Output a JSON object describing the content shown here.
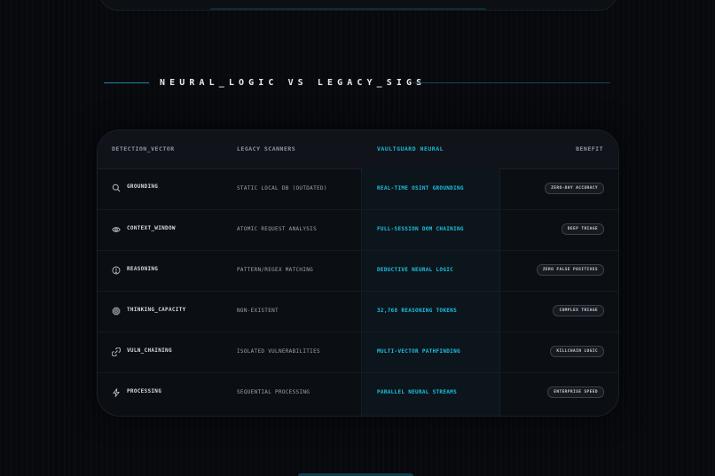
{
  "section": {
    "heading": "NEURAL_LOGIC VS LEGACY_SIGS"
  },
  "table": {
    "headers": {
      "vector": "DETECTION_VECTOR",
      "legacy": "LEGACY SCANNERS",
      "neural": "VAULTGUARD NEURAL",
      "benefit": "BENEFIT"
    },
    "rows": [
      {
        "icon": "search-icon",
        "vector": "GROUNDING",
        "legacy": "STATIC LOCAL DB (OUTDATED)",
        "neural": "REAL-TIME OSINT GROUNDING",
        "benefit": "ZERO-DAY ACCURACY"
      },
      {
        "icon": "eye-icon",
        "vector": "CONTEXT_WINDOW",
        "legacy": "ATOMIC REQUEST ANALYSIS",
        "neural": "FULL-SESSION DOM CHAINING",
        "benefit": "DEEP TRIAGE"
      },
      {
        "icon": "bulb-icon",
        "vector": "REASONING",
        "legacy": "PATTERN/REGEX MATCHING",
        "neural": "DEDUCTIVE NEURAL LOGIC",
        "benefit": "ZERO FALSE POSITIVES"
      },
      {
        "icon": "cpu-icon",
        "vector": "THINKING_CAPACITY",
        "legacy": "NON-EXISTENT",
        "neural": "32,768 REASONING TOKENS",
        "benefit": "COMPLEX TRIAGE"
      },
      {
        "icon": "chain-icon",
        "vector": "VULN_CHAINING",
        "legacy": "ISOLATED VULNERABILITIES",
        "neural": "MULTI-VECTOR PATHFINDING",
        "benefit": "KILLCHAIN LOGIC"
      },
      {
        "icon": "bolt-icon",
        "vector": "PROCESSING",
        "legacy": "SEQUENTIAL PROCESSING",
        "neural": "PARALLEL NEURAL STREAMS",
        "benefit": "ENTERPRISE SPEED"
      }
    ]
  },
  "colors": {
    "accent": "#1cc0e3",
    "background": "#07090d",
    "card": "#0b0e12"
  }
}
